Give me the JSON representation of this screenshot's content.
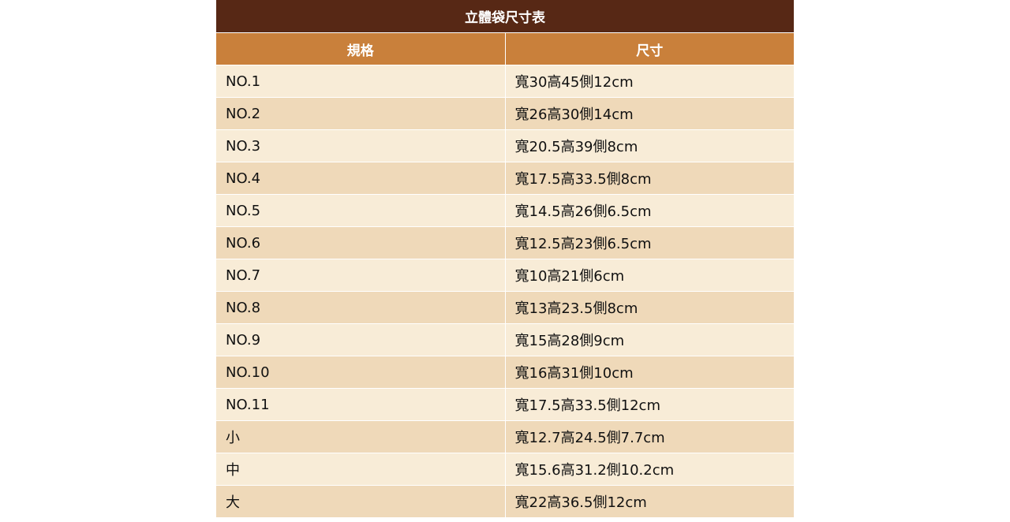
{
  "table": {
    "title": "立體袋尺寸表",
    "headers": [
      "規格",
      "尺寸"
    ],
    "rows": [
      {
        "spec": "NO.1",
        "size": "寬30高45側12cm"
      },
      {
        "spec": "NO.2",
        "size": "寬26高30側14cm"
      },
      {
        "spec": "NO.3",
        "size": "寬20.5高39側8cm"
      },
      {
        "spec": "NO.4",
        "size": "寬17.5高33.5側8cm"
      },
      {
        "spec": "NO.5",
        "size": "寬14.5高26側6.5cm"
      },
      {
        "spec": "NO.6",
        "size": "寬12.5高23側6.5cm"
      },
      {
        "spec": "NO.7",
        "size": "寬10高21側6cm"
      },
      {
        "spec": "NO.8",
        "size": "寬13高23.5側8cm"
      },
      {
        "spec": "NO.9",
        "size": "寬15高28側9cm"
      },
      {
        "spec": "NO.10",
        "size": "寬16高31側10cm"
      },
      {
        "spec": "NO.11",
        "size": "寬17.5高33.5側12cm"
      },
      {
        "spec": "小",
        "size": "寬12.7高24.5側7.7cm"
      },
      {
        "spec": "中",
        "size": "寬15.6高31.2側10.2cm"
      },
      {
        "spec": "大",
        "size": "寬22高36.5側12cm"
      }
    ]
  },
  "colors": {
    "title_bg": "#572815",
    "header_bg": "#c9803b",
    "row_light": "#f8ecd7",
    "row_dark": "#efd9b9"
  }
}
